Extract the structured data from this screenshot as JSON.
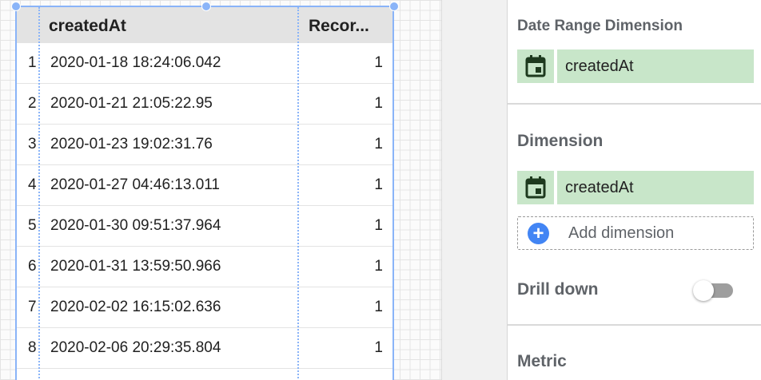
{
  "table": {
    "headers": {
      "created_at": "createdAt",
      "record_count": "Recor..."
    },
    "rows": [
      {
        "index": "1",
        "date": "2020-01-18 18:24:06.042",
        "value": "1"
      },
      {
        "index": "2",
        "date": "2020-01-21 21:05:22.95",
        "value": "1"
      },
      {
        "index": "3",
        "date": "2020-01-23 19:02:31.76",
        "value": "1"
      },
      {
        "index": "4",
        "date": "2020-01-27 04:46:13.011",
        "value": "1"
      },
      {
        "index": "5",
        "date": "2020-01-30 09:51:37.964",
        "value": "1"
      },
      {
        "index": "6",
        "date": "2020-01-31 13:59:50.966",
        "value": "1"
      },
      {
        "index": "7",
        "date": "2020-02-02 16:15:02.636",
        "value": "1"
      },
      {
        "index": "8",
        "date": "2020-02-06 20:29:35.804",
        "value": "1"
      }
    ]
  },
  "panel": {
    "date_range_dimension": {
      "title": "Date Range Dimension",
      "chip_label": "createdAt",
      "chip_icon": "calendar-icon"
    },
    "dimension": {
      "title": "Dimension",
      "chip_label": "createdAt",
      "chip_icon": "calendar-icon",
      "add_label": "Add dimension"
    },
    "drill_down": {
      "title": "Drill down",
      "enabled": false
    },
    "metric": {
      "title": "Metric"
    }
  },
  "colors": {
    "selection": "#8ab4f8",
    "chip_bg": "#c8e6c9",
    "chip_icon": "#1e3a1e",
    "add_button": "#4285f4",
    "section_title": "#5f6368"
  }
}
